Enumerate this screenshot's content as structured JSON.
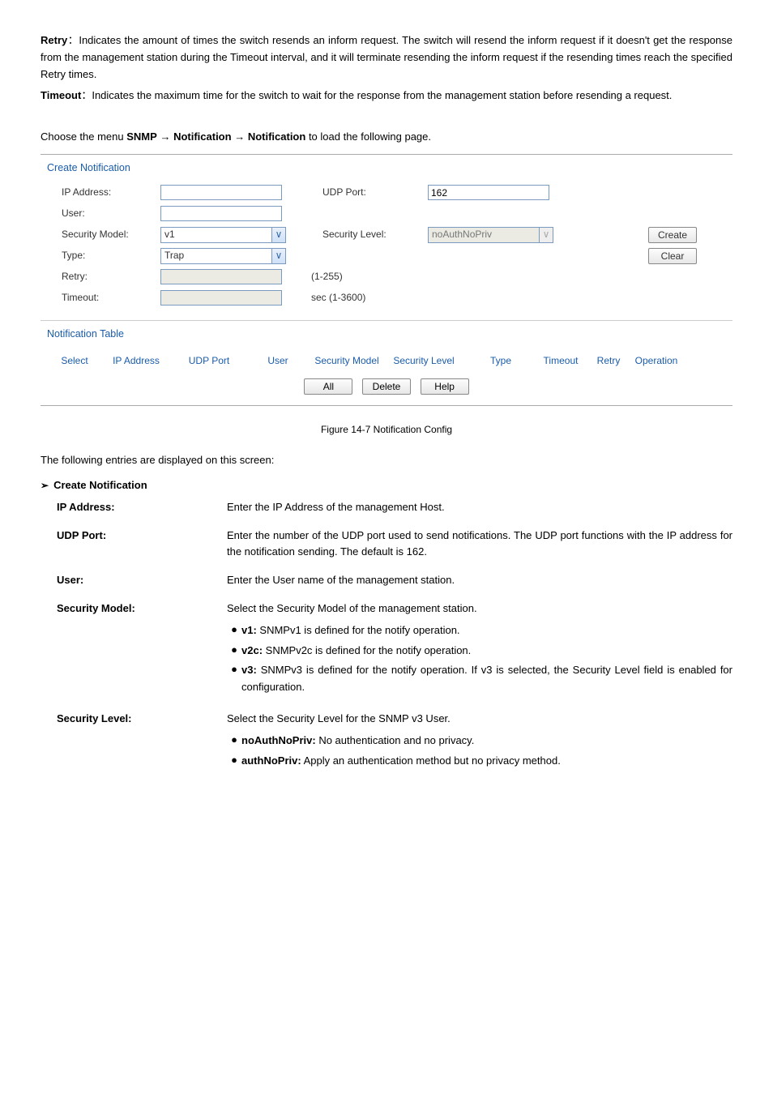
{
  "intro": {
    "retry_label": "Retry",
    "retry_text": "：Indicates the amount of times the switch resends an inform request. The switch will resend the inform request if it doesn't get the response from the management station during the Timeout interval, and it will terminate resending the inform request if the resending times reach the specified Retry times.",
    "timeout_label": "Timeout",
    "timeout_text": "：Indicates the maximum time for the switch to wait for the response from the management station before resending a request.",
    "path_prefix": "Choose the menu",
    "path_parts": [
      "SNMP",
      "Notification",
      "Notification"
    ],
    "path_suffix": "to load the following page."
  },
  "form": {
    "group_title": "Create Notification",
    "ip_label": "IP Address:",
    "udp_label": "UDP Port:",
    "udp_value": "162",
    "user_label": "User:",
    "secm_label": "Security Model:",
    "secm_value": "v1",
    "secl_label": "Security Level:",
    "secl_value": "noAuthNoPriv",
    "type_label": "Type:",
    "type_value": "Trap",
    "retry_label": "Retry:",
    "retry_hint": "(1-255)",
    "timeout_label": "Timeout:",
    "timeout_hint": "sec (1-3600)",
    "create_btn": "Create",
    "clear_btn": "Clear"
  },
  "table": {
    "group_title": "Notification Table",
    "cols": {
      "select": "Select",
      "ip": "IP Address",
      "udp": "UDP Port",
      "user": "User",
      "secm": "Security Model",
      "secl": "Security Level",
      "type": "Type",
      "timeout": "Timeout",
      "retry": "Retry",
      "op": "Operation"
    },
    "all_btn": "All",
    "delete_btn": "Delete",
    "help_btn": "Help"
  },
  "figure_caption": "Figure 14-7 Notification Config",
  "explain_heading": "The following entries are displayed on this screen:",
  "sec_title": "Create Notification",
  "desc": [
    {
      "label": "IP Address:",
      "text": "Enter the IP Address of the management Host."
    },
    {
      "label": "UDP Port:",
      "text": "Enter the number of the UDP port used to send notifications. The UDP port functions with the IP address for the notification sending. The default is 162."
    },
    {
      "label": "User:",
      "text": "Enter the User name of the management station."
    }
  ],
  "secm_desc": {
    "label": "Security Model:",
    "text": "Select the Security Model of the management station.",
    "bullets": [
      {
        "b": "v1:",
        "t": " SNMPv1 is defined for the notify operation."
      },
      {
        "b": "v2c:",
        "t": " SNMPv2c is defined for the notify operation."
      },
      {
        "b": "v3:",
        "t": " SNMPv3 is defined for the notify operation. If v3 is selected, the Security Level field is enabled for configuration."
      }
    ]
  },
  "secl_desc": {
    "label": "Security Level:",
    "text": "Select the Security Level for the SNMP v3 User.",
    "bullets": [
      {
        "b": "noAuthNoPriv:",
        "t": " No authentication and no privacy."
      },
      {
        "b": "authNoPriv:",
        "t": " Apply an authentication method but no privacy method."
      }
    ]
  }
}
